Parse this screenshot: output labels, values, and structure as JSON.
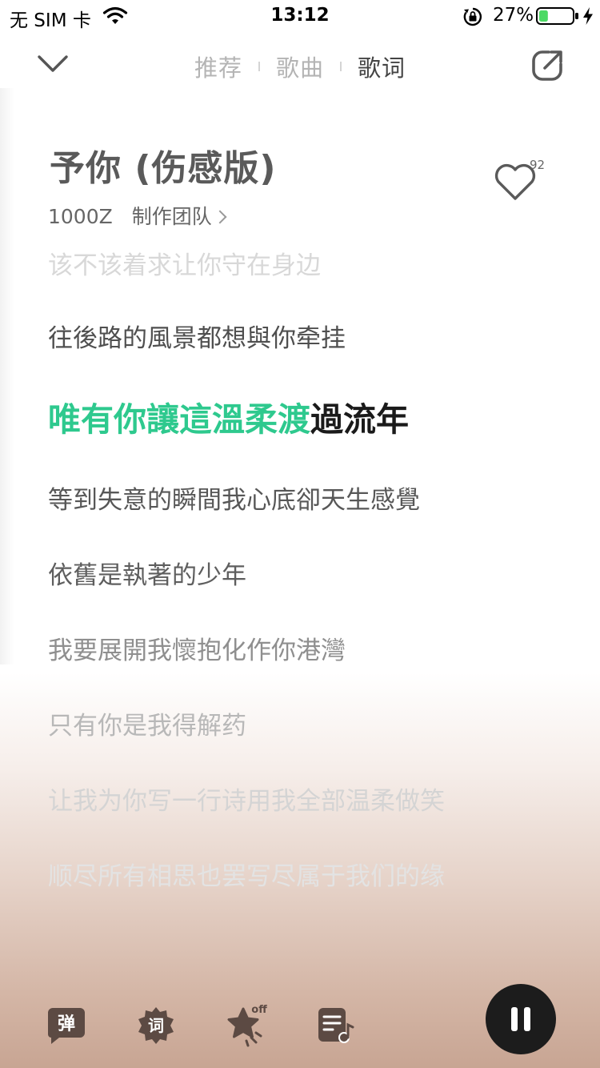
{
  "status_bar": {
    "carrier": "无 SIM 卡",
    "time": "13:12",
    "battery_percent": "27%",
    "battery_level": 0.27,
    "battery_color": "#4cd964"
  },
  "nav": {
    "tabs": [
      "推荐",
      "歌曲",
      "歌词"
    ],
    "active_tab": "歌词"
  },
  "song": {
    "title": "予你 (伤感版)",
    "artist": "1000Z",
    "team": "制作团队",
    "like_count": "92"
  },
  "lyrics": {
    "cut_line": "该不该着求让你守在身边",
    "line1": "往後路的風景都想與你牵挂",
    "current_sung": "唯有你讓這溫柔渡",
    "current_rest": "過流年",
    "line3": "等到失意的瞬間我心底卻天生感覺",
    "line4": "依舊是執著的少年",
    "line5": "我要展開我懷抱化作你港灣",
    "line6": "只有你是我得解药",
    "line7": "让我为你写一行诗用我全部温柔做笑",
    "line8": "顺尽所有相思也罢写尽属于我们的缘"
  },
  "controls": {
    "danmu_label": "弹",
    "ci_label": "词",
    "star_badge": "off"
  },
  "colors": {
    "highlight": "#2ec98e",
    "accent_dark": "#1c1c1c"
  }
}
